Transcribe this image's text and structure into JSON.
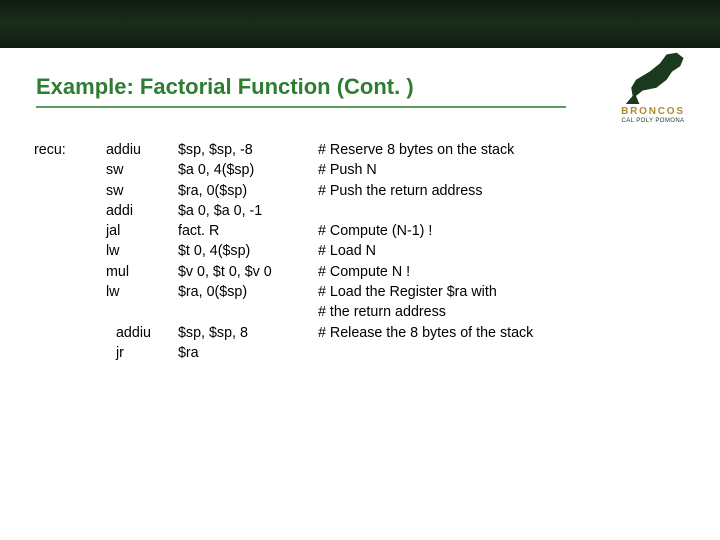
{
  "title": "Example: Factorial Function (Cont. )",
  "logo": {
    "broncos": "BRONCOS",
    "cpp": "CAL POLY POMONA"
  },
  "code": {
    "label": "recu:",
    "block1": [
      {
        "op": "addiu",
        "args": "$sp, $sp, -8",
        "cmt": "# Reserve 8 bytes on the stack"
      },
      {
        "op": "sw",
        "args": "$a 0, 4($sp)",
        "cmt": "# Push  N"
      },
      {
        "op": "sw",
        "args": "$ra, 0($sp)",
        "cmt": "# Push the return address"
      },
      {
        "op": "addi",
        "args": "$a 0, $a 0, -1",
        "cmt": ""
      },
      {
        "op": "jal",
        "args": "fact. R",
        "cmt": "# Compute (N-1) !"
      },
      {
        "op": "lw",
        "args": "$t 0, 4($sp)",
        "cmt": "# Load N"
      },
      {
        "op": "mul",
        "args": "$v 0, $t 0, $v 0",
        "cmt": "# Compute   N !"
      },
      {
        "op": "lw",
        "args": "$ra, 0($sp)",
        "cmt": "# Load the Register $ra with"
      },
      {
        "op": "",
        "args": "",
        "cmt": "# the return address"
      }
    ],
    "block2": [
      {
        "op": "addiu",
        "args": "$sp, $sp, 8",
        "cmt": "# Release the 8 bytes of the stack"
      },
      {
        "op": "jr",
        "args": "$ra",
        "cmt": ""
      }
    ]
  }
}
